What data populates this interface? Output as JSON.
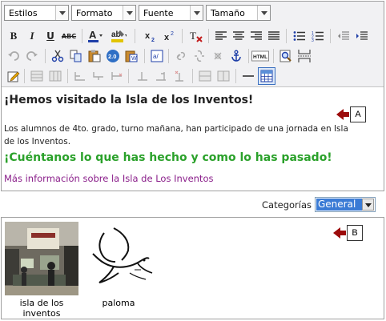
{
  "toolbar": {
    "combos": [
      {
        "label": "Estilos"
      },
      {
        "label": "Formato"
      },
      {
        "label": "Fuente"
      },
      {
        "label": "Tamaño"
      }
    ]
  },
  "content": {
    "heading": "¡Hemos visitado la Isla de los Inventos!",
    "paragraph": "Los alumnos de 4to. grado, turno mañana, han participado de una jornada en Isla de los Inventos.",
    "subheading": "¡Cuéntanos lo que has hecho y como lo has pasado!",
    "link": "Más información sobre la Isla de Los Inventos"
  },
  "markers": {
    "a": "A",
    "b": "B"
  },
  "categories": {
    "label": "Categorías",
    "selected": "General"
  },
  "gallery": {
    "items": [
      {
        "caption_line1": "isla de los",
        "caption_line2": "inventos"
      },
      {
        "caption_line1": "paloma",
        "caption_line2": ""
      }
    ]
  },
  "colors": {
    "heading2": "#2aa12a",
    "link": "#8a1e8a",
    "marker": "#9c0b0b",
    "select_highlight": "#3a7bd5"
  }
}
